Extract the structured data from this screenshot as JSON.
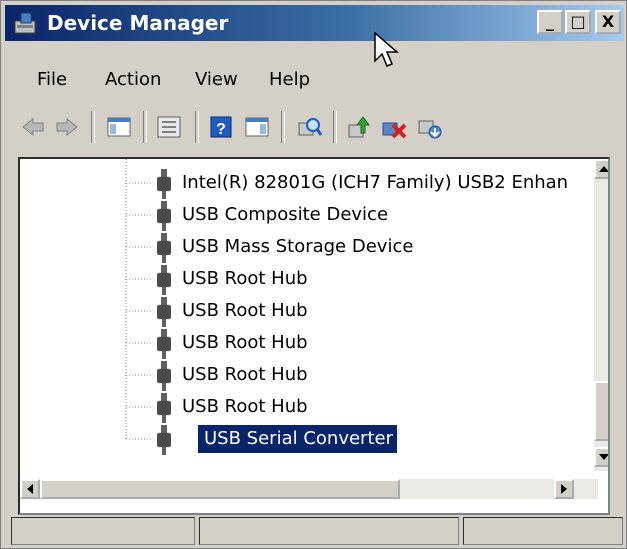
{
  "window": {
    "title": "Device Manager",
    "controls": [
      "_",
      "□",
      "X"
    ]
  },
  "menu": {
    "items": [
      "File",
      "Action",
      "View",
      "Help"
    ]
  },
  "toolbar": {
    "icons": [
      "back-icon",
      "forward-icon",
      "show-hide-console-tree-icon",
      "properties-icon",
      "help-icon",
      "action-pane-icon",
      "scan-for-hardware-changes-icon",
      "update-driver-icon",
      "uninstall-icon",
      "enable-icon"
    ]
  },
  "tree": {
    "items": [
      {
        "label": "Intel(R) 82801G (ICH7 Family) USB2 Enhan",
        "selected": false
      },
      {
        "label": "USB Composite Device",
        "selected": false
      },
      {
        "label": "USB Mass Storage Device",
        "selected": false
      },
      {
        "label": "USB Root Hub",
        "selected": false
      },
      {
        "label": "USB Root Hub",
        "selected": false
      },
      {
        "label": "USB Root Hub",
        "selected": false
      },
      {
        "label": "USB Root Hub",
        "selected": false
      },
      {
        "label": "USB Root Hub",
        "selected": false
      },
      {
        "label": "USB Serial Converter",
        "selected": true
      }
    ]
  },
  "colors": {
    "selection": "#0a246a",
    "titlebar_start": "#0a246a",
    "titlebar_end": "#a6caf0",
    "chrome": "#d4d0c8"
  }
}
